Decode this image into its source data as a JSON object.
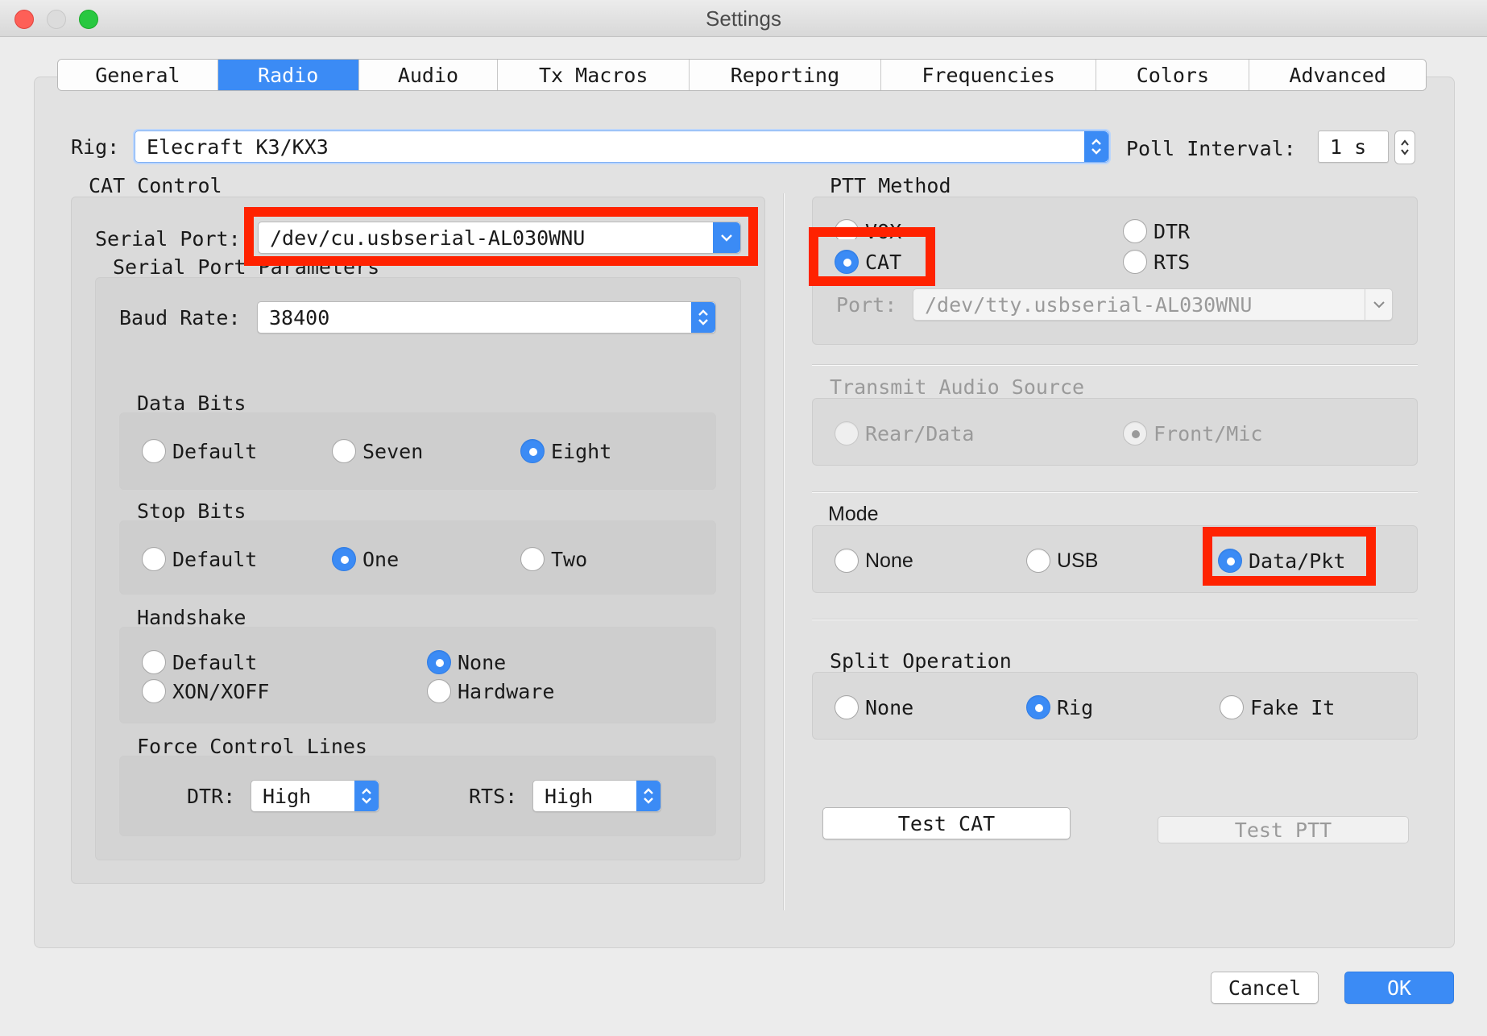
{
  "window": {
    "title": "Settings"
  },
  "tabs": [
    {
      "label": "General",
      "active": false
    },
    {
      "label": "Radio",
      "active": true
    },
    {
      "label": "Audio",
      "active": false
    },
    {
      "label": "Tx Macros",
      "active": false
    },
    {
      "label": "Reporting",
      "active": false
    },
    {
      "label": "Frequencies",
      "active": false
    },
    {
      "label": "Colors",
      "active": false
    },
    {
      "label": "Advanced",
      "active": false
    }
  ],
  "rig": {
    "label": "Rig:",
    "value": "Elecraft K3/KX3"
  },
  "poll": {
    "label": "Poll Interval:",
    "value": "1 s"
  },
  "cat": {
    "title": "CAT Control",
    "serial_port_label": "Serial Port:",
    "serial_port_value": "/dev/cu.usbserial-AL030WNU",
    "params_title": "Serial Port Parameters",
    "baud_label": "Baud Rate:",
    "baud_value": "38400",
    "data_bits": {
      "title": "Data Bits",
      "options": [
        "Default",
        "Seven",
        "Eight"
      ],
      "selected": "Eight"
    },
    "stop_bits": {
      "title": "Stop Bits",
      "options": [
        "Default",
        "One",
        "Two"
      ],
      "selected": "One"
    },
    "handshake": {
      "title": "Handshake",
      "options": [
        "Default",
        "None",
        "XON/XOFF",
        "Hardware"
      ],
      "selected": "None"
    },
    "force": {
      "title": "Force Control Lines",
      "dtr_label": "DTR:",
      "dtr_value": "High",
      "rts_label": "RTS:",
      "rts_value": "High"
    }
  },
  "ptt": {
    "title": "PTT Method",
    "options": [
      "VOX",
      "DTR",
      "CAT",
      "RTS"
    ],
    "selected": "CAT",
    "port_label": "Port:",
    "port_value": "/dev/tty.usbserial-AL030WNU"
  },
  "tx_audio": {
    "title": "Transmit Audio Source",
    "options": [
      "Rear/Data",
      "Front/Mic"
    ],
    "selected": "Front/Mic"
  },
  "mode": {
    "title": "Mode",
    "options": [
      "None",
      "USB",
      "Data/Pkt"
    ],
    "selected": "Data/Pkt"
  },
  "split": {
    "title": "Split Operation",
    "options": [
      "None",
      "Rig",
      "Fake It"
    ],
    "selected": "Rig"
  },
  "buttons": {
    "test_cat": "Test CAT",
    "test_ptt": "Test PTT",
    "cancel": "Cancel",
    "ok": "OK"
  },
  "colors": {
    "accent": "#3b8bf5",
    "highlight": "#ff2200"
  }
}
